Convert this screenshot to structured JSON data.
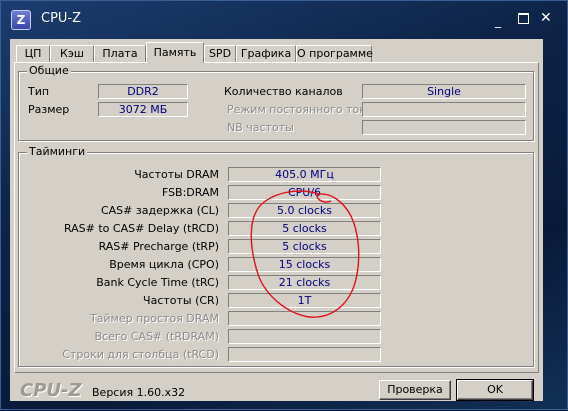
{
  "window": {
    "title": "CPU-Z",
    "icon_letter": "Z",
    "controls": {
      "minimize": "_",
      "close": "✕"
    }
  },
  "tabs": [
    {
      "label": "ЦП"
    },
    {
      "label": "Кэш"
    },
    {
      "label": "Плата"
    },
    {
      "label": "Память",
      "active": true
    },
    {
      "label": "SPD"
    },
    {
      "label": "Графика"
    },
    {
      "label": "О программе"
    }
  ],
  "general": {
    "legend": "Общие",
    "type_label": "Тип",
    "type_value": "DDR2",
    "size_label": "Размер",
    "size_value": "3072 МБ",
    "channels_label": "Количество каналов",
    "channels_value": "Single",
    "dc_mode_label": "Режим постоянного тока",
    "dc_mode_value": "",
    "nb_freq_label": "NB частоты",
    "nb_freq_value": ""
  },
  "timings": {
    "legend": "Тайминги",
    "rows": [
      {
        "label": "Частоты DRAM",
        "value": "405.0 МГц",
        "disabled": false
      },
      {
        "label": "FSB:DRAM",
        "value": "CPU/6",
        "disabled": false
      },
      {
        "label": "CAS# задержка (CL)",
        "value": "5.0 clocks",
        "disabled": false
      },
      {
        "label": "RAS# to CAS# Delay (tRCD)",
        "value": "5 clocks",
        "disabled": false
      },
      {
        "label": "RAS# Precharge (tRP)",
        "value": "5 clocks",
        "disabled": false
      },
      {
        "label": "Время цикла (CPO)",
        "value": "15 clocks",
        "disabled": false
      },
      {
        "label": "Bank Cycle Time (tRC)",
        "value": "21 clocks",
        "disabled": false
      },
      {
        "label": "Частоты (CR)",
        "value": "1T",
        "disabled": false
      },
      {
        "label": "Таймер простоя DRAM",
        "value": "",
        "disabled": true
      },
      {
        "label": "Всего CAS# (tRDRAM)",
        "value": "",
        "disabled": true
      },
      {
        "label": "Строки для столбца (tRCD)",
        "value": "",
        "disabled": true
      }
    ]
  },
  "footer": {
    "logo": "CPU-Z",
    "version": "Версия 1.60.x32",
    "validate_label": "Проверка",
    "ok_label": "OK"
  },
  "annotation": {
    "color": "#e0101a"
  }
}
